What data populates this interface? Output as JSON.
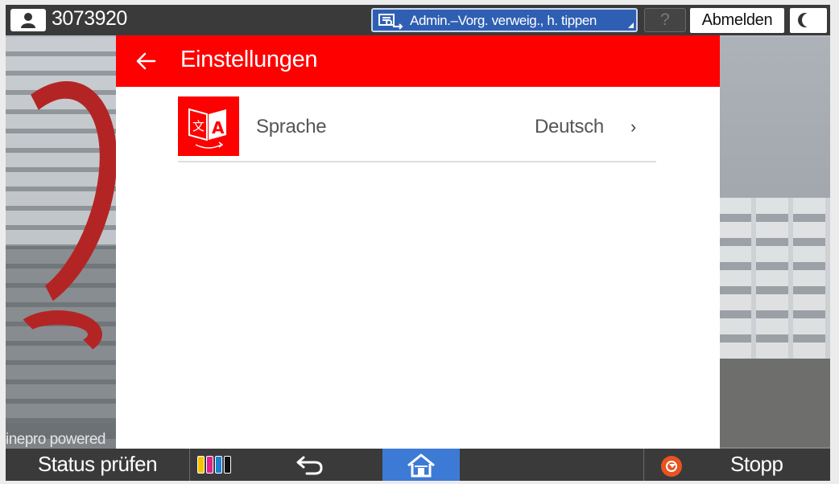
{
  "topbar": {
    "user_id": "3073920",
    "admin_status": "Admin.–Vorg. verweig., h. tippen",
    "help_label": "?",
    "logout_label": "Abmelden"
  },
  "panel": {
    "title": "Einstellungen",
    "rows": [
      {
        "label": "Sprache",
        "value": "Deutsch",
        "icon": "language-icon"
      }
    ]
  },
  "watermark": "inepro powered",
  "bottombar": {
    "status_label": "Status prüfen",
    "stop_label": "Stopp",
    "toner_colors": [
      "#f5c400",
      "#e0208c",
      "#1e7fd6",
      "#111111"
    ]
  },
  "colors": {
    "header_red": "#ff0000",
    "home_blue": "#3d7ad6",
    "admin_blue": "#2f5fb3",
    "stop_orange": "#e8531f"
  }
}
